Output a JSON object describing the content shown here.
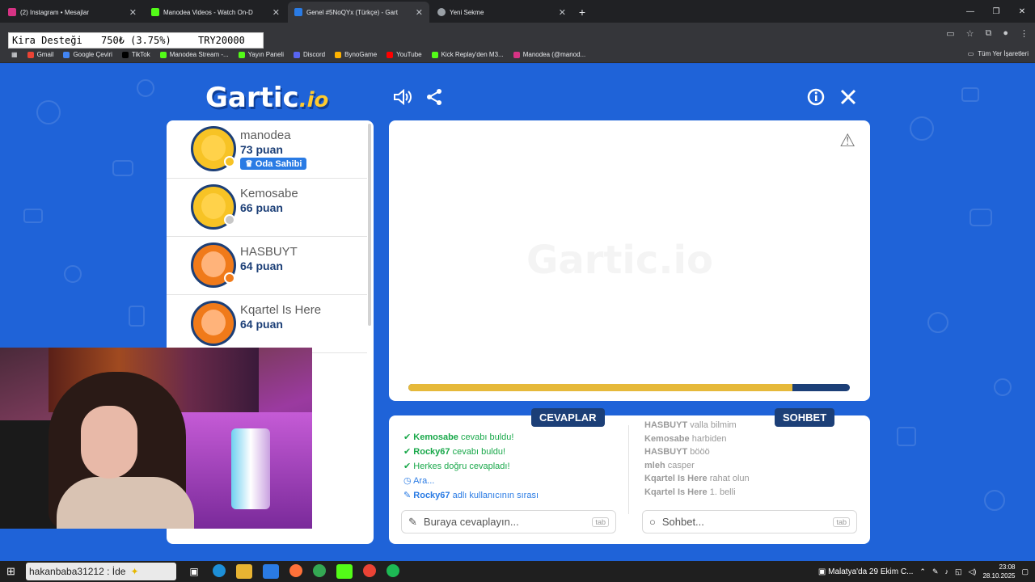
{
  "browser": {
    "tabs": [
      {
        "title": "(2) Instagram • Mesajlar",
        "color": "#d63384",
        "active": false
      },
      {
        "title": "Manodea Videos - Watch On-D",
        "color": "#53fc18",
        "active": false
      },
      {
        "title": "Genel #5NoQYx (Türkçe) - Gart",
        "color": "#2a7be4",
        "active": true
      },
      {
        "title": "Yeni Sekme",
        "color": "#9aa0a6",
        "active": false
      }
    ],
    "bookmarks": [
      "Gmail",
      "Google Çeviri",
      "TikTok",
      "Manodea Stream -...",
      "Yayın Paneli",
      "Discord",
      "BynoGame",
      "YouTube",
      "Kick Replay'den M3...",
      "Manodea (@manod..."
    ],
    "bookmark_colors": [
      "#ea4335",
      "#4285f4",
      "#000000",
      "#53fc18",
      "#53fc18",
      "#5865f2",
      "#ffb300",
      "#ff0000",
      "#53fc18",
      "#d63384"
    ],
    "all_bookmarks": "Tüm Yer İşaretleri"
  },
  "donation": {
    "label": "Kira Desteği",
    "amount": "750₺ (3.75%)",
    "goal": "TRY20000",
    "percent": 3.75
  },
  "game": {
    "logo_main": "Gartic",
    "logo_suffix": ".io",
    "watermark": "Gartic.io",
    "players": [
      {
        "name": "manodea",
        "score": "73 puan",
        "badge": "Oda Sahibi",
        "status_color": "#f7c325",
        "ring_color": "#f7c325",
        "face_color": "#ffd24a"
      },
      {
        "name": "Kemosabe",
        "score": "66 puan",
        "badge": "",
        "status_color": "#c7c7c7",
        "ring_color": "#f7c325",
        "face_color": "#ffd24a"
      },
      {
        "name": "HASBUYT",
        "score": "64 puan",
        "badge": "",
        "status_color": "#f07a1a",
        "ring_color": "#f07a1a",
        "face_color": "#ffb37a"
      },
      {
        "name": "Kqartel Is Here",
        "score": "64 puan",
        "badge": "",
        "status_color": "",
        "ring_color": "#f07a1a",
        "face_color": "#ffb37a"
      }
    ],
    "timer_progress": 0.87,
    "answers_title": "CEVAPLAR",
    "chat_title": "SOHBET",
    "answers": [
      {
        "icon": "check",
        "nick": "Kemosabe",
        "text": "cevabı buldu!"
      },
      {
        "icon": "check",
        "nick": "Rocky67",
        "text": "cevabı buldu!"
      },
      {
        "icon": "check",
        "nick": "",
        "text": "Herkes doğru cevapladı!"
      },
      {
        "icon": "clock",
        "nick": "",
        "text": "Ara..."
      },
      {
        "icon": "pencil",
        "nick": "Rocky67",
        "text": "adlı kullanıcının sırası"
      }
    ],
    "chat": [
      {
        "nick": "HASBUYT",
        "text": "valla bilmim"
      },
      {
        "nick": "Kemosabe",
        "text": "harbiden"
      },
      {
        "nick": "HASBUYT",
        "text": "bööö"
      },
      {
        "nick": "mleh",
        "text": "casper"
      },
      {
        "nick": "Kqartel Is Here",
        "text": "rahat olun"
      },
      {
        "nick": "Kqartel Is Here",
        "text": "1. belli"
      }
    ],
    "answer_placeholder": "Buraya cevaplayın...",
    "chat_placeholder": "Sohbet...",
    "tab_key": "tab"
  },
  "taskbar": {
    "search_text": "hakanbaba31212 : İde",
    "weather": "Malatya'da 29 Ekim C...",
    "time": "23:08",
    "date": "28.10.2025"
  }
}
